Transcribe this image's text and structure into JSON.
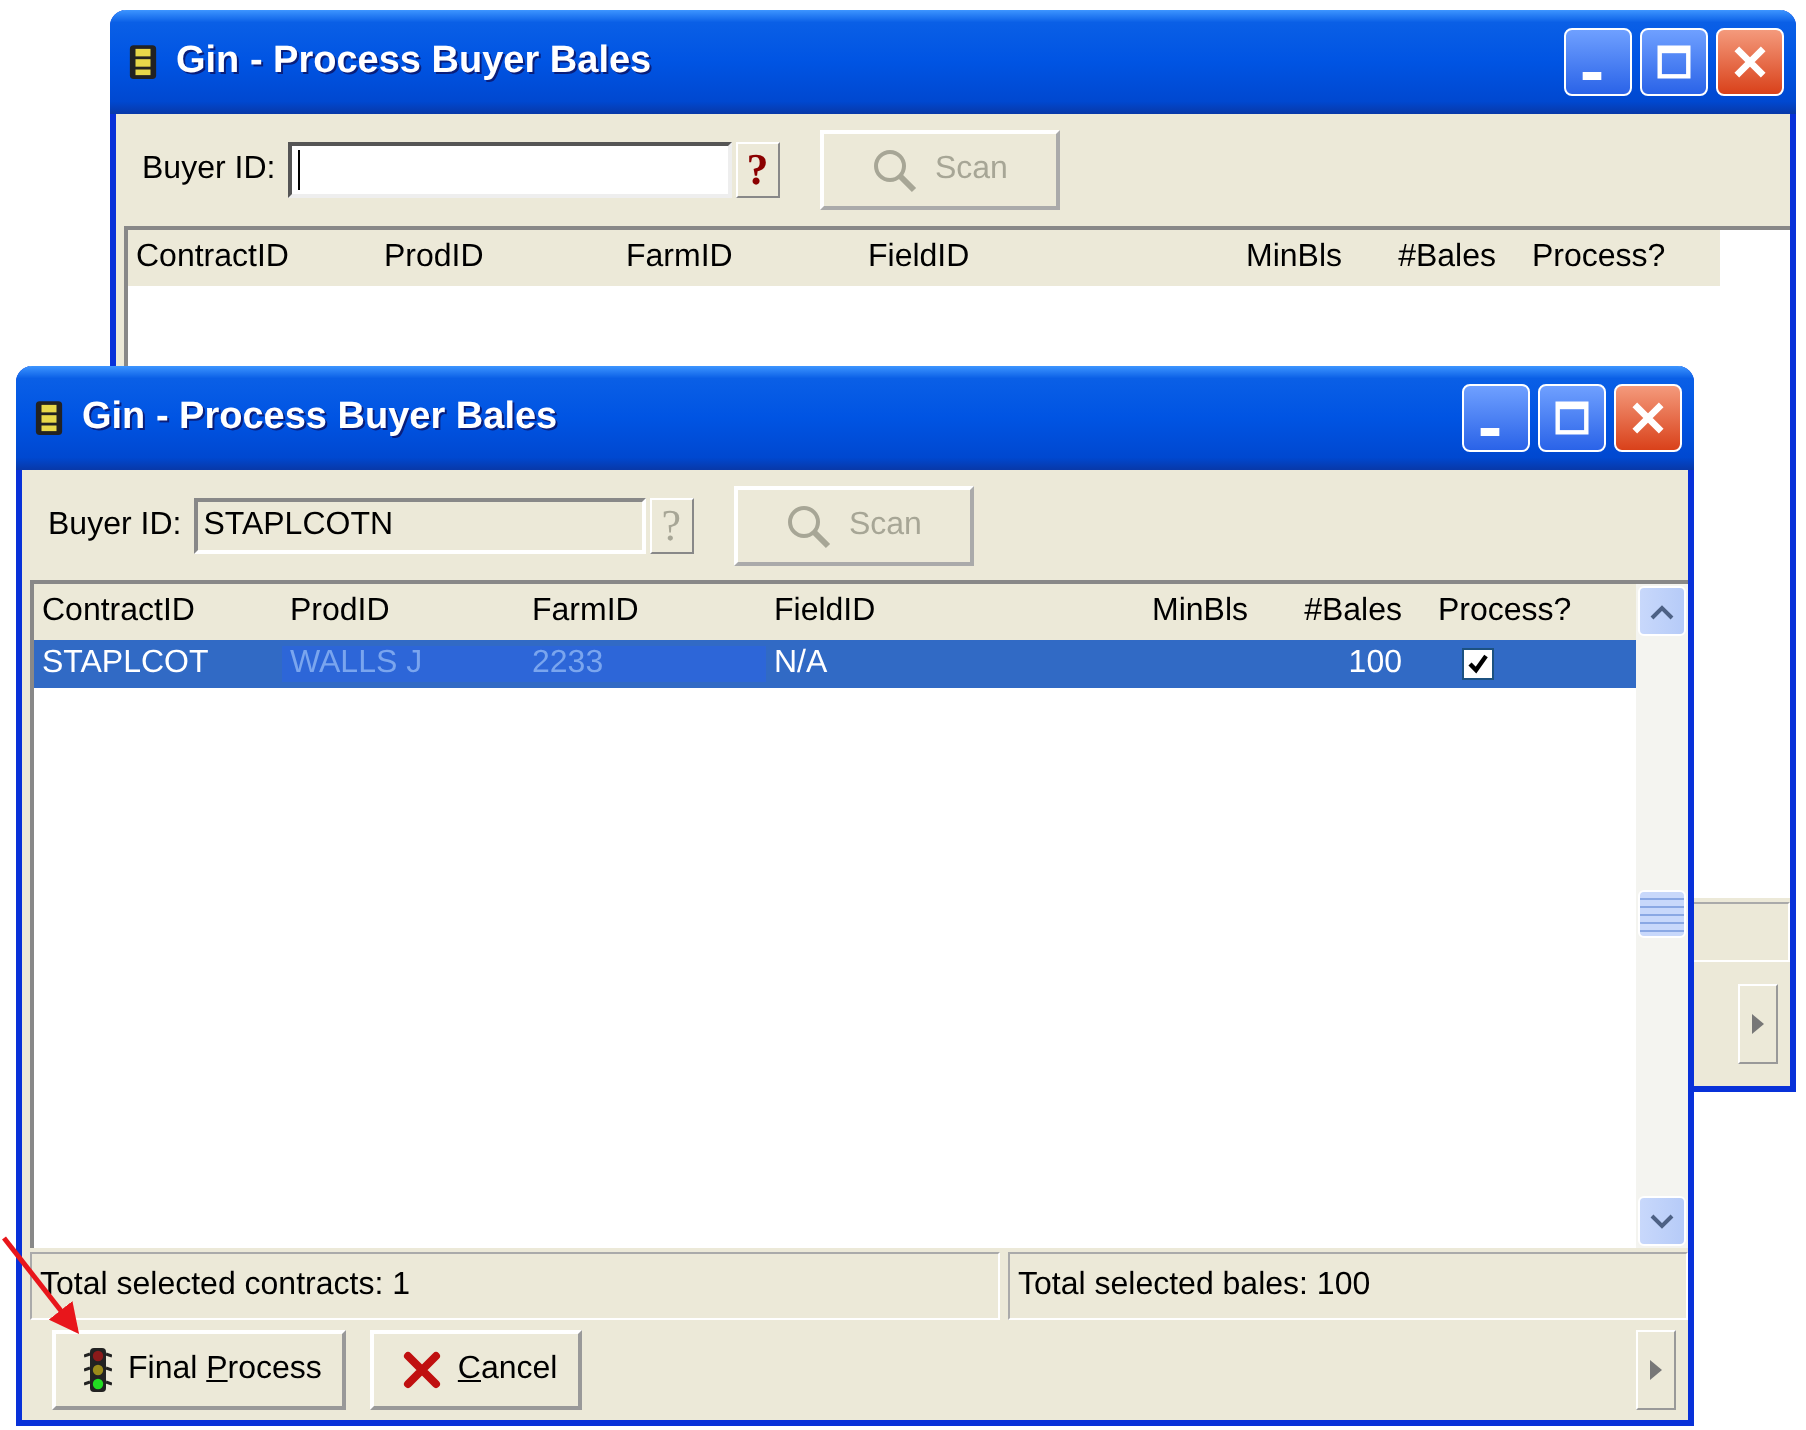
{
  "windows": [
    {
      "title": "Gin - Process Buyer Bales",
      "buyer_id": {
        "label": "Buyer ID:",
        "focused": true,
        "disabled": false
      },
      "help_button": {
        "text": "?",
        "disabled": false
      },
      "scan_button": {
        "label": "Scan",
        "disabled": true
      },
      "columns": [
        "ContractID",
        "ProdID",
        "FarmID",
        "FieldID",
        "MinBls",
        "#Bales",
        "Process?"
      ]
    },
    {
      "title": "Gin - Process Buyer Bales",
      "buyer_id": {
        "label": "Buyer ID:",
        "value": "STAPLCOTN",
        "focused": false,
        "disabled": true
      },
      "help_button": {
        "text": "?",
        "disabled": true
      },
      "scan_button": {
        "label": "Scan",
        "disabled": true
      },
      "columns": [
        "ContractID",
        "ProdID",
        "FarmID",
        "FieldID",
        "MinBls",
        "#Bales",
        "Process?"
      ],
      "rows": [
        {
          "selected": true,
          "contract_id": {
            "text": "STAPLCOT",
            "dimmed": false
          },
          "prod_id": {
            "text": "WALLS J",
            "dimmed": true
          },
          "farm_id": {
            "text": "2233",
            "dimmed": true
          },
          "field_id": {
            "text": "N/A",
            "dimmed": false
          },
          "bales": {
            "text": "100",
            "dimmed": false
          },
          "process": {
            "checked": true
          }
        }
      ],
      "vertical_scrollbar": true,
      "status_bar": [
        "Total selected contracts: 1",
        "Total selected bales: 100"
      ],
      "buttons": [
        {
          "kind": "process",
          "lead": "Final ",
          "key": "P",
          "rest": "rocess"
        },
        {
          "kind": "cancel",
          "key": "C",
          "rest": "ancel"
        }
      ]
    }
  ]
}
